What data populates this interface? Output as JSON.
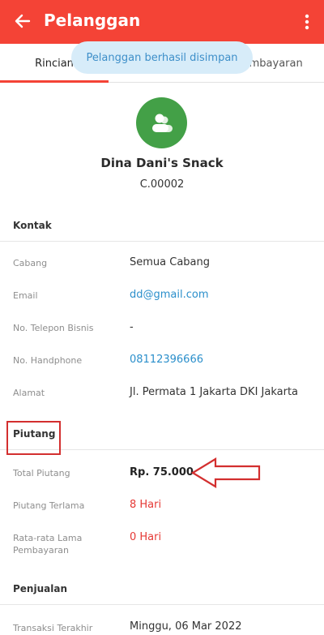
{
  "header": {
    "title": "Pelanggan",
    "back_icon": "arrow-left-icon",
    "menu_icon": "more-vertical-icon",
    "color": "#f44336"
  },
  "tabs": [
    {
      "label": "Rincian",
      "active": true
    },
    {
      "label": "Pembayaran",
      "active": false
    }
  ],
  "toast": {
    "text": "Pelanggan berhasil disimpan"
  },
  "customer": {
    "name": "Dina Dani's Snack",
    "code": "C.00002",
    "avatar_icon": "people-icon",
    "avatar_color": "#43a047"
  },
  "sections": {
    "kontak": "Kontak",
    "piutang": "Piutang",
    "penjualan": "Penjualan"
  },
  "kontak": {
    "cabang": {
      "label": "Cabang",
      "value": "Semua Cabang"
    },
    "email": {
      "label": "Email",
      "value": "dd@gmail.com"
    },
    "telepon": {
      "label": "No. Telepon Bisnis",
      "value": "-"
    },
    "handphone": {
      "label": "No. Handphone",
      "value": "08112396666"
    },
    "alamat": {
      "label": "Alamat",
      "value": "Jl. Permata 1 Jakarta DKI Jakarta"
    }
  },
  "piutang": {
    "total": {
      "label": "Total Piutang",
      "value": "Rp. 75.000"
    },
    "terlama": {
      "label": "Piutang Terlama",
      "value": "8 Hari"
    },
    "rata": {
      "label": "Rata-rata Lama Pembayaran",
      "value": "0 Hari"
    }
  },
  "penjualan": {
    "terakhir": {
      "label": "Transaksi Terakhir",
      "value": "Minggu, 06 Mar 2022"
    }
  },
  "annotations": {
    "box_color": "#d32f2f",
    "arrow_color": "#d32f2f"
  }
}
